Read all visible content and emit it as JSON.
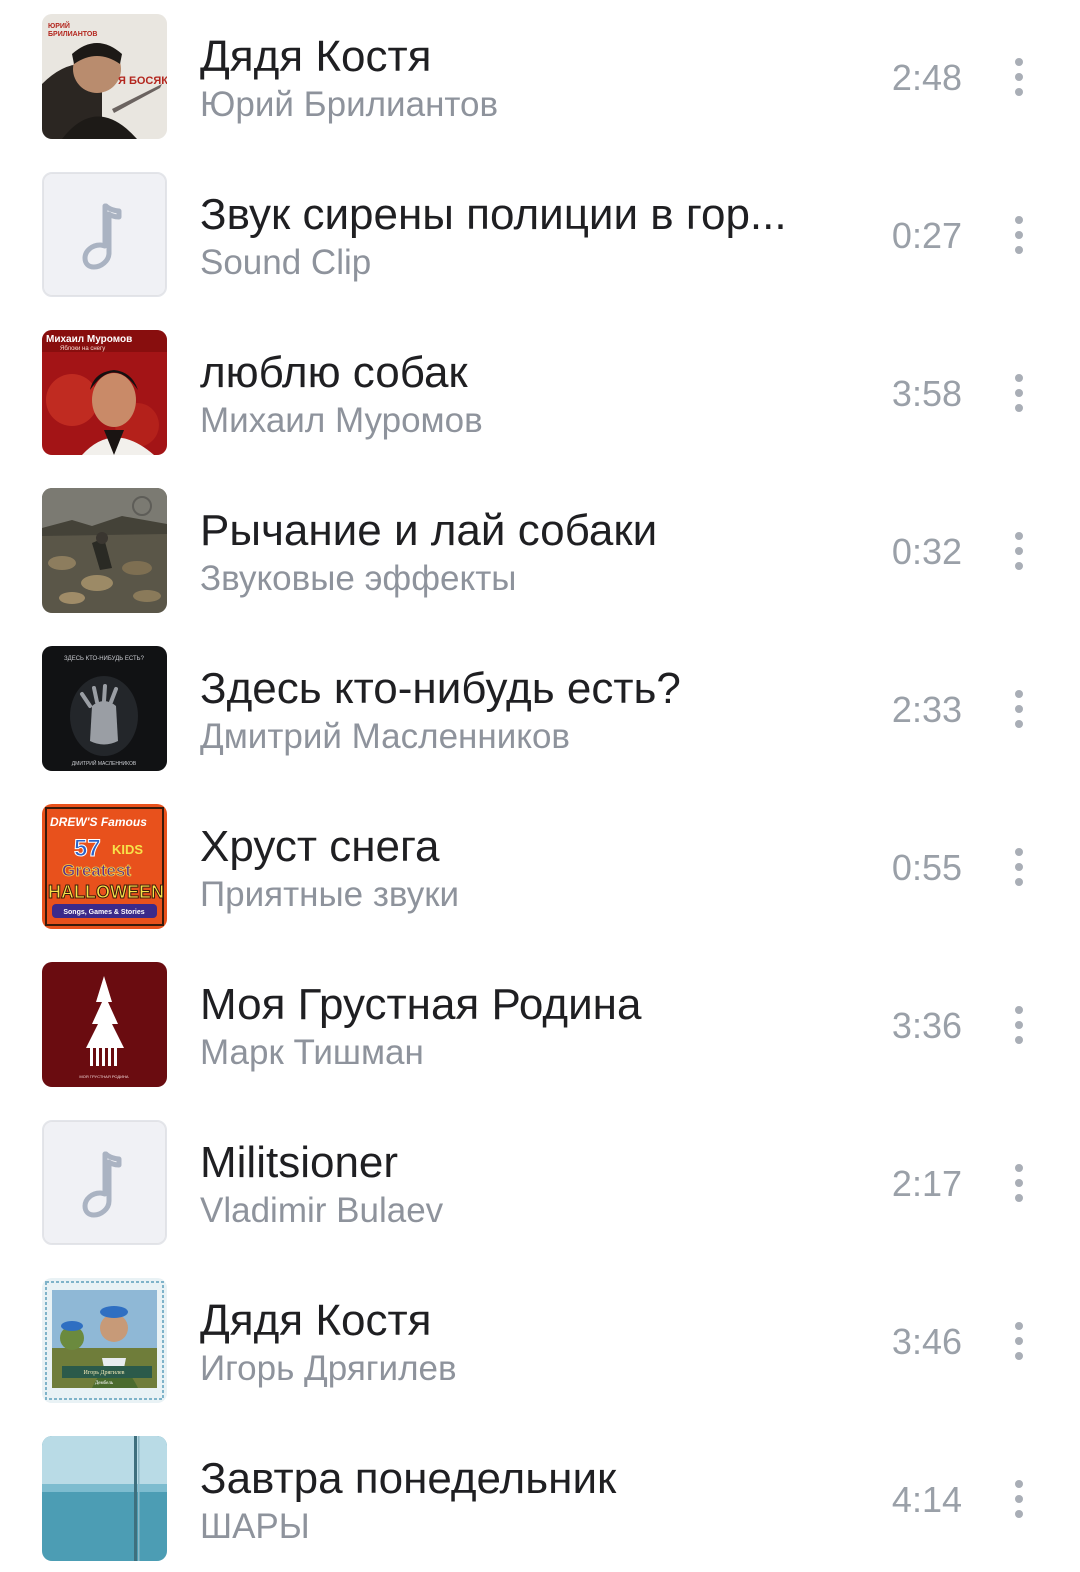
{
  "tracks": [
    {
      "title": "Дядя Костя",
      "artist": "Юрий Брилиантов",
      "duration": "2:48",
      "cover": "brilliantov-ya-bosyak",
      "cover_text_1": "ЮРИЙ",
      "cover_text_2": "БРИЛИАНТОВ",
      "cover_text_3": "Я БОСЯК"
    },
    {
      "title": "Звук сирены полиции в гор...",
      "artist": "Sound Clip",
      "duration": "0:27",
      "cover": "music-note-placeholder"
    },
    {
      "title": "люблю собак",
      "artist": "Михаил Муромов",
      "duration": "3:58",
      "cover": "muromov-yabloki-na-snegu",
      "cover_text_1": "Михаил Муромов",
      "cover_text_2": "Яблоки на снегу"
    },
    {
      "title": "Рычание и лай собаки",
      "artist": "Звуковые эффекты",
      "duration": "0:32",
      "cover": "dogs-pack-photo"
    },
    {
      "title": "Здесь кто-нибудь есть?",
      "artist": "Дмитрий Масленников",
      "duration": "2:33",
      "cover": "dark-hand-cover",
      "cover_text_1": "ЗДЕСЬ КТО-НИБУДЬ ЕСТЬ?",
      "cover_text_2": "ДМИТРИЙ МАСЛЕННИКОВ"
    },
    {
      "title": "Хруст снега",
      "artist": "Приятные звуки",
      "duration": "0:55",
      "cover": "drews-famous-halloween",
      "cover_text_1": "DREW'S Famous",
      "cover_text_2": "57",
      "cover_text_3": "KIDS",
      "cover_text_4": "Greatest",
      "cover_text_5": "HALLOWEEN",
      "cover_text_6": "Songs, Games & Stories"
    },
    {
      "title": "Моя Грустная Родина",
      "artist": "Марк Тишман",
      "duration": "3:36",
      "cover": "tree-on-dark-red",
      "cover_text_1": "МОЯ ГРУСТНАЯ РОДИНА"
    },
    {
      "title": "Militsioner",
      "artist": "Vladimir Bulaev",
      "duration": "2:17",
      "cover": "music-note-placeholder"
    },
    {
      "title": "Дядя Костя",
      "artist": "Игорь Дрягилев",
      "duration": "3:46",
      "cover": "soldiers-blue-berets",
      "cover_text_1": "Игорь Дрягилев",
      "cover_text_2": "Дембель"
    },
    {
      "title": "Завтра понедельник",
      "artist": "ШАРЫ",
      "duration": "4:14",
      "cover": "teal-water-pole"
    }
  ],
  "more_icon": "vertical-ellipsis-icon",
  "colors": {
    "title": "#1f1f22",
    "artist": "#8e939c",
    "duration": "#9aa0a8",
    "placeholder_bg": "#f0f1f5",
    "placeholder_note": "#aab3c2"
  }
}
